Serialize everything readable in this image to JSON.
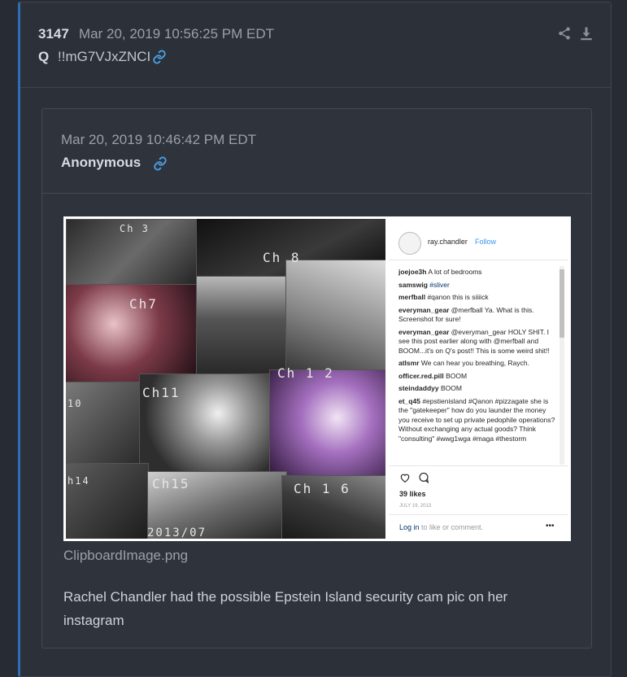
{
  "post": {
    "number": "3147",
    "date": "Mar 20, 2019 10:56:25 PM EDT",
    "author": "Q",
    "tripcode": "!!mG7VJxZNCI",
    "icons": {
      "link": "link-icon",
      "share": "share-icon",
      "download": "download-icon"
    }
  },
  "reference": {
    "date": "Mar 20, 2019 10:46:42 PM EDT",
    "author": "Anonymous",
    "filename": "ClipboardImage.png",
    "message": "Rachel Chandler had the possible Epstein Island security cam pic on her instagram"
  },
  "image": {
    "channels": [
      "Ch 3",
      "Ch 8",
      "Ch7",
      "Ch 1 2",
      "Ch11",
      "10",
      "h14",
      "Ch15",
      "Ch 1 6",
      "2013/07"
    ],
    "instagram": {
      "username": "ray.chandler",
      "follow": "Follow",
      "comments": [
        {
          "user": "joejoe3h",
          "text": "A lot of bedrooms"
        },
        {
          "user": "samswig",
          "text": "#sliver"
        },
        {
          "user": "merfball",
          "text": "#qanon this is siiiick"
        },
        {
          "user": "everyman_gear",
          "text": "@merfball Ya. What is this. Screenshot for sure!"
        },
        {
          "user": "everyman_gear",
          "text": "@everyman_gear HOLY SHIT. I see this post earlier along with @merfball and BOOM...it's on Q's post!! This is some weird shit!!"
        },
        {
          "user": "atlsmr",
          "text": "We can hear you breathing, Raych."
        },
        {
          "user": "officer.red.pill",
          "text": "BOOM"
        },
        {
          "user": "steindaddyy",
          "text": "BOOM"
        },
        {
          "user": "et_q45",
          "text": "#epstienisland #Qanon #pizzagate she is the \"gatekeeper\" how do you launder the money you receive to set up private pedophile operations? Without exchanging any actual goods? Think \"consulting\" #wwg1wga #maga #thestorm"
        }
      ],
      "likes": "39 likes",
      "date": "JULY 19, 2013",
      "login_link": "Log in",
      "login_text": " to like or comment.",
      "more": "•••"
    }
  },
  "colors": {
    "accent": "#2f6db8",
    "link": "#4a9de0",
    "background": "#272b33",
    "panel": "#2b3039"
  }
}
